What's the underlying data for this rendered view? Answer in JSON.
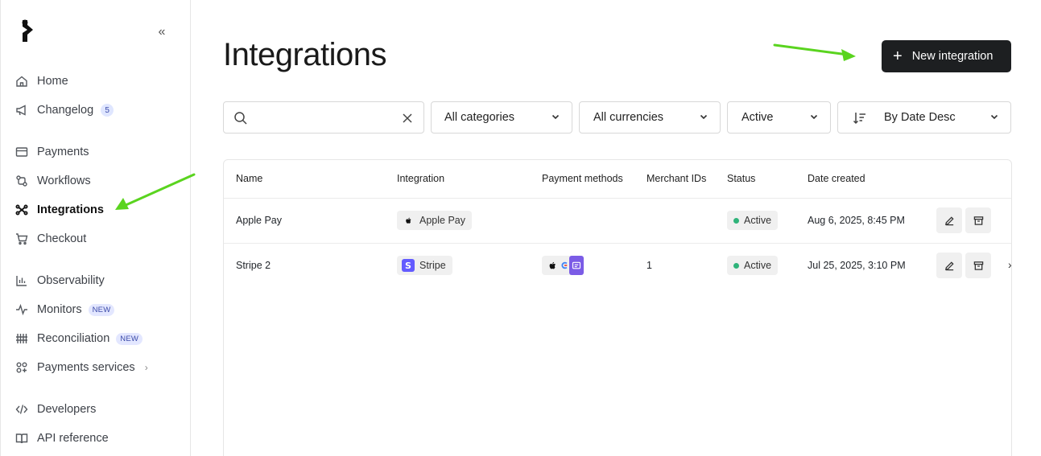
{
  "sidebar": {
    "collapse_icon": "double-chevron-left-icon",
    "items": [
      {
        "label": "Home",
        "icon": "home-icon"
      },
      {
        "label": "Changelog",
        "icon": "megaphone-icon",
        "badge": "5"
      },
      {
        "label": "Payments",
        "icon": "credit-card-icon"
      },
      {
        "label": "Workflows",
        "icon": "workflow-icon"
      },
      {
        "label": "Integrations",
        "icon": "integrations-icon",
        "active": true
      },
      {
        "label": "Checkout",
        "icon": "cart-icon"
      },
      {
        "label": "Observability",
        "icon": "bar-chart-icon"
      },
      {
        "label": "Monitors",
        "icon": "pulse-icon",
        "badge": "NEW"
      },
      {
        "label": "Reconciliation",
        "icon": "reconciliation-icon",
        "badge": "NEW"
      },
      {
        "label": "Payments services",
        "icon": "services-icon"
      },
      {
        "label": "Developers",
        "icon": "code-icon"
      },
      {
        "label": "API reference",
        "icon": "book-icon"
      }
    ]
  },
  "header": {
    "title": "Integrations",
    "new_button_label": "New integration"
  },
  "filters": {
    "search_value": "",
    "category": "All categories",
    "currency": "All currencies",
    "status": "Active",
    "sort": "By Date Desc"
  },
  "table": {
    "columns": [
      "Name",
      "Integration",
      "Payment methods",
      "Merchant IDs",
      "Status",
      "Date created"
    ],
    "rows": [
      {
        "name": "Apple Pay",
        "integration": "Apple Pay",
        "merchant_ids": "",
        "status": "Active",
        "date": "Aug 6, 2025, 8:45 PM"
      },
      {
        "name": "Stripe 2",
        "integration": "Stripe",
        "merchant_ids": "1",
        "status": "Active",
        "date": "Jul 25, 2025, 3:10 PM"
      }
    ]
  },
  "colors": {
    "accent_dark": "#1d1f21",
    "status_active": "#2fb37a",
    "stripe_purple": "#635bff",
    "annotation_arrow": "#5ad41f"
  }
}
